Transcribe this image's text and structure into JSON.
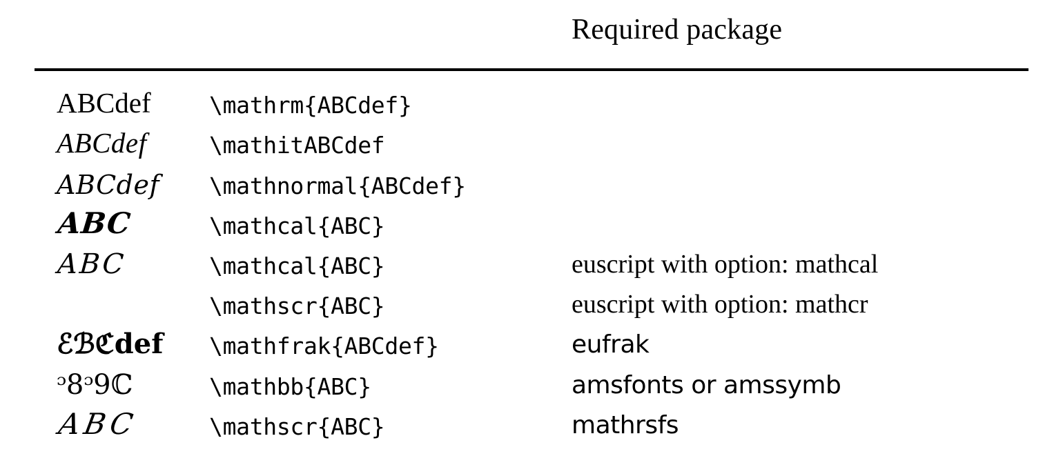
{
  "header": {
    "required_package_label": "Required package"
  },
  "table": {
    "rows": [
      {
        "sample": "ABCdef",
        "sample_style": "s-rm",
        "command": "\\mathrm{ABCdef}",
        "package": "",
        "package_style": "p-serif"
      },
      {
        "sample": "ABCdef",
        "sample_style": "s-it",
        "command": "\\mathitABCdef",
        "package": "",
        "package_style": "p-serif"
      },
      {
        "sample": "ABCdef",
        "sample_style": "s-normal",
        "command": "\\mathnormal{ABCdef}",
        "package": "",
        "package_style": "p-serif"
      },
      {
        "sample": "ABC",
        "sample_style": "s-cal",
        "command": "\\mathcal{ABC}",
        "package": "",
        "package_style": "p-serif"
      },
      {
        "sample": "ABC",
        "sample_style": "s-eus",
        "command": "\\mathcal{ABC}",
        "package": "euscript with option: mathcal",
        "package_style": "p-serif"
      },
      {
        "sample": "",
        "sample_style": "s-eus",
        "command": "\\mathscr{ABC}",
        "package": "euscript with option: mathcr",
        "package_style": "p-serif"
      },
      {
        "sample": "ℰℬℭdef",
        "sample_style": "s-frak",
        "command": "\\mathfrak{ABCdef}",
        "package": "eufrak",
        "package_style": "p-sans"
      },
      {
        "sample": "ᵓ8ᵓ9ℂ",
        "sample_style": "s-bb",
        "command": "\\mathbb{ABC}",
        "package": "amsfonts or amssymb",
        "package_style": "p-sans"
      },
      {
        "sample": "ABC",
        "sample_style": "s-rsfs",
        "command": "\\mathscr{ABC}",
        "package": "mathrsfs",
        "package_style": "p-sans"
      }
    ]
  },
  "colors": {
    "text": "#000000",
    "rule": "#000000",
    "background": "#ffffff"
  }
}
